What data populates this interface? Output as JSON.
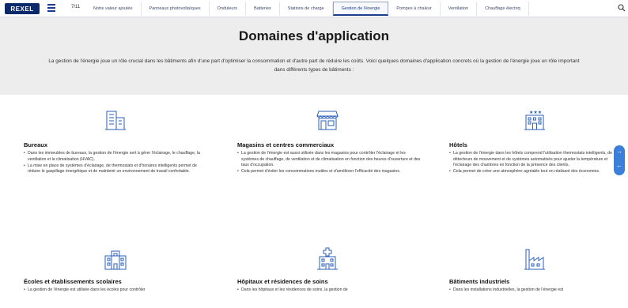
{
  "header": {
    "logo": "REXEL",
    "counter": "7/11",
    "tabs": [
      {
        "label": "Notre valeur ajoutée"
      },
      {
        "label": "Panneaux photovoltaïques"
      },
      {
        "label": "Onduleurs"
      },
      {
        "label": "Batteries"
      },
      {
        "label": "Stations de charge"
      },
      {
        "label": "Gestion de l'énergie"
      },
      {
        "label": "Pompes à chaleur"
      },
      {
        "label": "Ventilation"
      },
      {
        "label": "Chauffage électriq"
      }
    ],
    "active_tab": "Gestion de l'énergie"
  },
  "hero": {
    "title": "Domaines d'application",
    "intro": "La gestion de l'énergie joue un rôle crucial dans les bâtiments afin d'une part d'optimiser la consommation et d'autre part de réduire les coûts. Voici quelques domaines d'application concrets où la gestion de l'énergie joue un rôle important dans différents types de bâtiments :"
  },
  "cards": [
    {
      "icon": "office-building-icon",
      "title": "Bureaux",
      "bullets": [
        "Dans les immeubles de bureaux, la gestion de l'énergie sert à gérer l'éclairage, le chauffage, la ventilation et la climatisation (HVAC).",
        "La mise en place de systèmes d'éclairage, de thermostats et d'horaires intelligents permet de réduire le gaspillage énergétique et de maintenir un environnement de travail confortable."
      ]
    },
    {
      "icon": "shop-icon",
      "title": "Magasins et centres commerciaux",
      "bullets": [
        "La gestion de l'énergie est aussi utilisée dans les magasins pour contrôler l'éclairage et les systèmes de chauffage, de ventilation et de climatisation en fonction des heures d'ouverture et des taux d'occupation.",
        "Cela permet d'éviter les consommations inutiles et d'améliorer l'efficacité des magasins."
      ]
    },
    {
      "icon": "hotel-icon",
      "title": "Hôtels",
      "bullets": [
        "La gestion de l'énergie dans les hôtels comprend l'utilisation thermostats intelligents, de détecteurs de mouvement et de systèmes automatisés pour ajuster la température et l'éclairage des chambres en fonction de la présence des clients.",
        "Cela permet de créer une atmosphère agréable tout en réalisant des économies."
      ]
    },
    {
      "icon": "school-icon",
      "title": "Écoles et établissements scolaires",
      "bullets": [
        "La gestion de l'énergie est utilisée dans les écoles pour contrôler"
      ]
    },
    {
      "icon": "hospital-icon",
      "title": "Hôpitaux et résidences de soins",
      "bullets": [
        "Dans les hôpitaux et les résidences de soins, la gestion de"
      ]
    },
    {
      "icon": "factory-icon",
      "title": "Bâtiments industriels",
      "bullets": [
        "Dans les installations industrielles, la gestion de l'énergie est"
      ]
    }
  ],
  "colors": {
    "brand": "#0a2a6b",
    "accent": "#1d3b8b",
    "icon_blue": "#2b5fb8",
    "hero_bg": "#ededed",
    "side_nav": "#3b7fd9"
  }
}
